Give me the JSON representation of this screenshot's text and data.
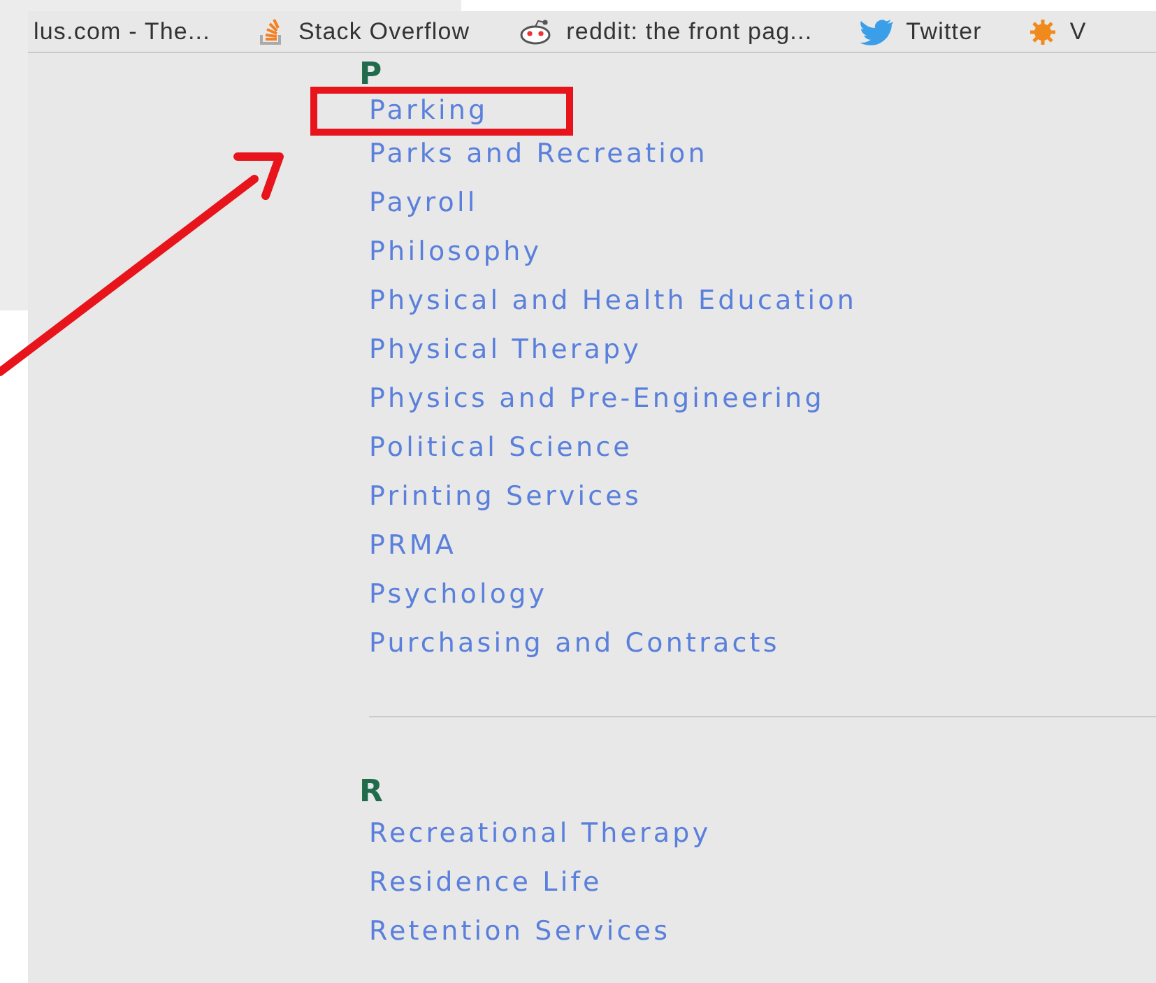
{
  "bookmarks": [
    {
      "label": "lus.com - The...",
      "kind": "plain"
    },
    {
      "label": "Stack Overflow",
      "kind": "stack"
    },
    {
      "label": "reddit: the front pag...",
      "kind": "alien"
    },
    {
      "label": "Twitter",
      "kind": "bird"
    },
    {
      "label": "V",
      "kind": "gear"
    }
  ],
  "sections": [
    {
      "letter": "P",
      "links": [
        {
          "label": "Parking",
          "highlighted": true
        },
        {
          "label": "Parks and Recreation",
          "highlighted": false
        },
        {
          "label": "Payroll",
          "highlighted": false
        },
        {
          "label": "Philosophy",
          "highlighted": false
        },
        {
          "label": "Physical and Health Education",
          "highlighted": false
        },
        {
          "label": "Physical Therapy",
          "highlighted": false
        },
        {
          "label": "Physics and Pre-Engineering",
          "highlighted": false
        },
        {
          "label": "Political Science",
          "highlighted": false
        },
        {
          "label": "Printing Services",
          "highlighted": false
        },
        {
          "label": "PRMA",
          "highlighted": false
        },
        {
          "label": "Psychology",
          "highlighted": false
        },
        {
          "label": "Purchasing and Contracts",
          "highlighted": false
        }
      ]
    },
    {
      "letter": "R",
      "links": [
        {
          "label": "Recreational Therapy",
          "highlighted": false
        },
        {
          "label": "Residence Life",
          "highlighted": false
        },
        {
          "label": "Retention Services",
          "highlighted": false
        }
      ]
    }
  ]
}
